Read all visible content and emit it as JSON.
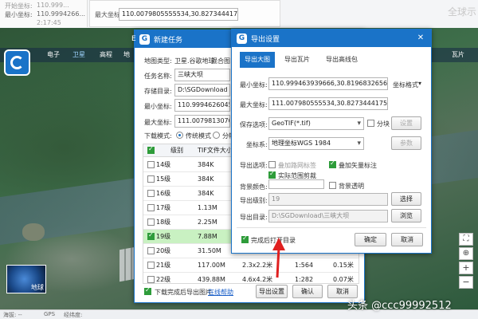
{
  "colors": {
    "accent": "#1a73c8",
    "highlight_row": "#c9f1c2",
    "check_green": "#2e9c3a",
    "arrow_red": "#e02020"
  },
  "background": {
    "right_text": "全球示"
  },
  "left_panel": {
    "row1_label": "开始坐标:",
    "row1_value": "110.999...",
    "row2_label": "最小坐标:",
    "row2_value": "110.9994266...",
    "row3_value": "2:17:45"
  },
  "mid_panel": {
    "label": "最大坐标:",
    "value": "110.0079805555534,30.827344417572"
  },
  "map_tabs": [
    "电子",
    "卫星",
    "高程"
  ],
  "map_tab_partial": "地",
  "map_tab_right": "瓦片",
  "map_overview": {
    "label": "地球"
  },
  "statusbar": [
    "海拔: --",
    "GPS",
    "经纬度:"
  ],
  "zoom_controls": {
    "fullscreen": "⛶",
    "reset": "⊕",
    "plus": "+",
    "minus": "−"
  },
  "watermark": "头条 @ccc99992512",
  "task_dialog": {
    "title": "新建任务",
    "title_left_char": "E",
    "map_type_label": "地图类型:",
    "map_type_value": "卫星.谷歌地球",
    "map_type_value2": "混合图",
    "task_name_label": "任务名称:",
    "task_name_value": "三峡大坝",
    "store_dir_label": "存储目录:",
    "store_dir_value": "D:\\SGDownload",
    "min_coord_label": "最小坐标:",
    "min_coord_value": "110.9994626045 22,30",
    "max_coord_label": "最大坐标:",
    "max_coord_value": "111.0079813070 29,30",
    "mode_label": "下载模式:",
    "mode_traditional": "传统模式",
    "mode_tile": "分幅",
    "columns": [
      "级别",
      "TIF文件大小"
    ],
    "rows": [
      {
        "level": "14级",
        "size": "384K",
        "checked": false
      },
      {
        "level": "15级",
        "size": "384K",
        "checked": false
      },
      {
        "level": "16级",
        "size": "384K",
        "checked": false
      },
      {
        "level": "17级",
        "size": "1.13M",
        "checked": false
      },
      {
        "level": "18级",
        "size": "2.25M",
        "checked": false
      },
      {
        "level": "19级",
        "size": "7.88M",
        "checked": true,
        "col3": "",
        "col4": "",
        "col5": ""
      },
      {
        "level": "20级",
        "size": "31.50M",
        "checked": false
      },
      {
        "level": "21级",
        "size": "117.00M",
        "checked": false,
        "col3": "2.3x2.2米",
        "col4": "1:564",
        "col5": "0.15米"
      },
      {
        "level": "22级",
        "size": "439.88M",
        "checked": false,
        "col3": "4.6x4.2米",
        "col4": "1:282",
        "col5": "0.07米"
      }
    ],
    "export_after_label": "下载完成后导出图片",
    "help_link": "在线帮助",
    "export_settings_button": "导出设置",
    "ok_button": "确认",
    "cancel_button": "取消"
  },
  "export_dialog": {
    "title": "导出设置",
    "tabs": [
      "导出大图",
      "导出瓦片",
      "导出高线包"
    ],
    "min_coord_label": "最小坐标:",
    "min_coord_value": "110.999463939666,30.819683265686",
    "coord_format": "坐标格式",
    "max_coord_label": "最大坐标:",
    "max_coord_value": "111.007980555534,30.827344417572",
    "save_option_label": "保存选项:",
    "save_option_value": "GeoTIF(*.tif)",
    "tile_label": "分块",
    "settings_button": "设置",
    "crs_label": "坐标系:",
    "crs_value": "地理坐标WGS 1984",
    "params_button": "参数",
    "export_option_label": "导出选项:",
    "opt_road": "叠加路网标签",
    "opt_vector": "叠加矢量标注",
    "opt_clip": "实际范围剪裁",
    "bg_color_label": "背景颜色:",
    "bg_transparent": "背景透明",
    "export_level_label": "导出级别:",
    "export_level_value": "19",
    "choose_button": "选择",
    "export_dir_label": "导出目录:",
    "export_dir_value": "D:\\SGDownload\\三峡大坝",
    "browse_button": "浏览",
    "open_after_label": "完成后打开目录",
    "ok_button": "确定",
    "cancel_button": "取消"
  }
}
